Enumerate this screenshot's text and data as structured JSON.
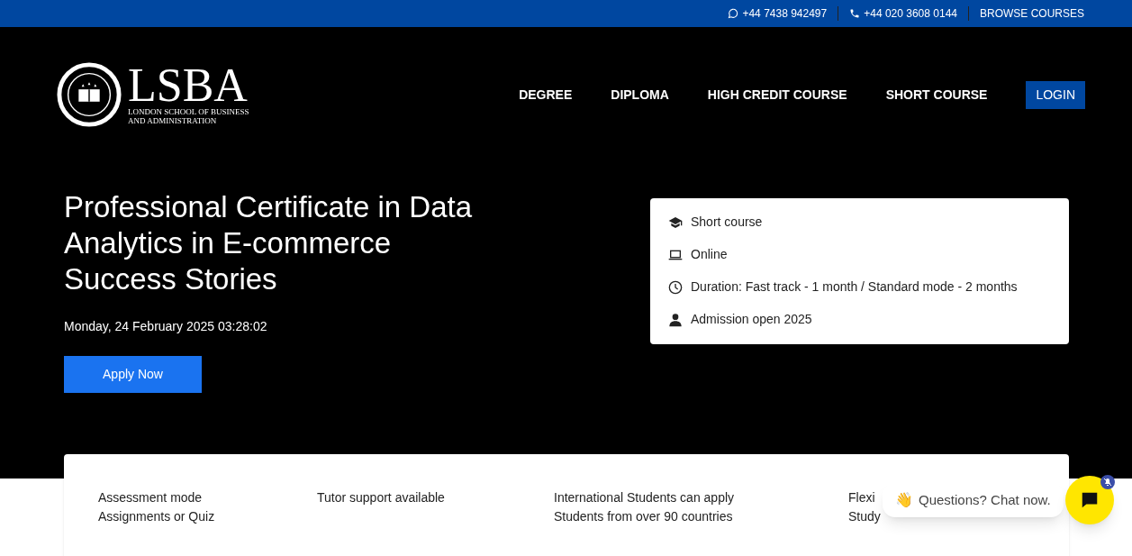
{
  "top_bar": {
    "whatsapp": "+44 7438 942497",
    "phone": "+44 020 3608 0144",
    "browse": "BROWSE COURSES"
  },
  "logo": {
    "wordmark": "LSBA",
    "line_1": "LONDON SCHOOL OF BUSINESS",
    "line_2": "AND ADMINISTRATION"
  },
  "nav": [
    {
      "label": "DEGREE",
      "kind": "link"
    },
    {
      "label": "DIPLOMA",
      "kind": "link"
    },
    {
      "label": "HIGH CREDIT COURSE",
      "kind": "link"
    },
    {
      "label": "SHORT COURSE",
      "kind": "link"
    },
    {
      "label": "LOGIN",
      "kind": "button"
    }
  ],
  "hero": {
    "title": "Professional Certificate in Data Analytics in E-commerce Success Stories",
    "datetime": "Monday, 24 February 2025 03:28:02",
    "apply": "Apply Now"
  },
  "info_card": [
    {
      "kind": "cap",
      "text": "Short course"
    },
    {
      "kind": "laptop",
      "text": "Online"
    },
    {
      "kind": "clock",
      "text": "Duration: Fast track - 1 month / Standard mode - 2 months"
    },
    {
      "kind": "person",
      "text": "Admission open 2025"
    }
  ],
  "features": [
    {
      "title": "Assessment mode",
      "detail": "Assignments or Quiz"
    },
    {
      "title": "Tutor support available"
    },
    {
      "title": "International Students can apply",
      "detail": "Students from over 90 countries"
    },
    {
      "title": "Flexi",
      "detail": "Study"
    }
  ],
  "chat": {
    "emoji": "👋",
    "prompt": "Questions? Chat now."
  }
}
